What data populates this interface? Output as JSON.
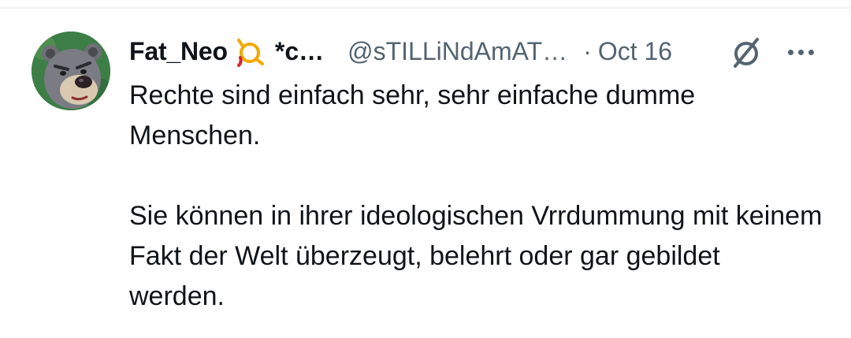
{
  "tweet": {
    "display_name": "Fat_Neo",
    "name_suffix": "*c…",
    "handle": "@sTILLiNdAmAT…",
    "separator": "·",
    "timestamp": "Oct 16",
    "paragraphs": [
      "Rechte sind einfach sehr, sehr einfache dumme Menschen.",
      "Sie können in ihrer ideologischen Vrrdummung mit keinem Fakt der Welt überzeugt, belehrt oder gar gebildet werden."
    ]
  },
  "icons": {
    "avatar": "bear-avatar",
    "badge": "post-horn-icon",
    "mute": "mute-circle-slash-icon",
    "more": "more-dots-icon"
  },
  "colors": {
    "text_primary": "#0f1419",
    "text_secondary": "#536471",
    "badge_gold": "#f2a900",
    "badge_red": "#d9252a"
  }
}
